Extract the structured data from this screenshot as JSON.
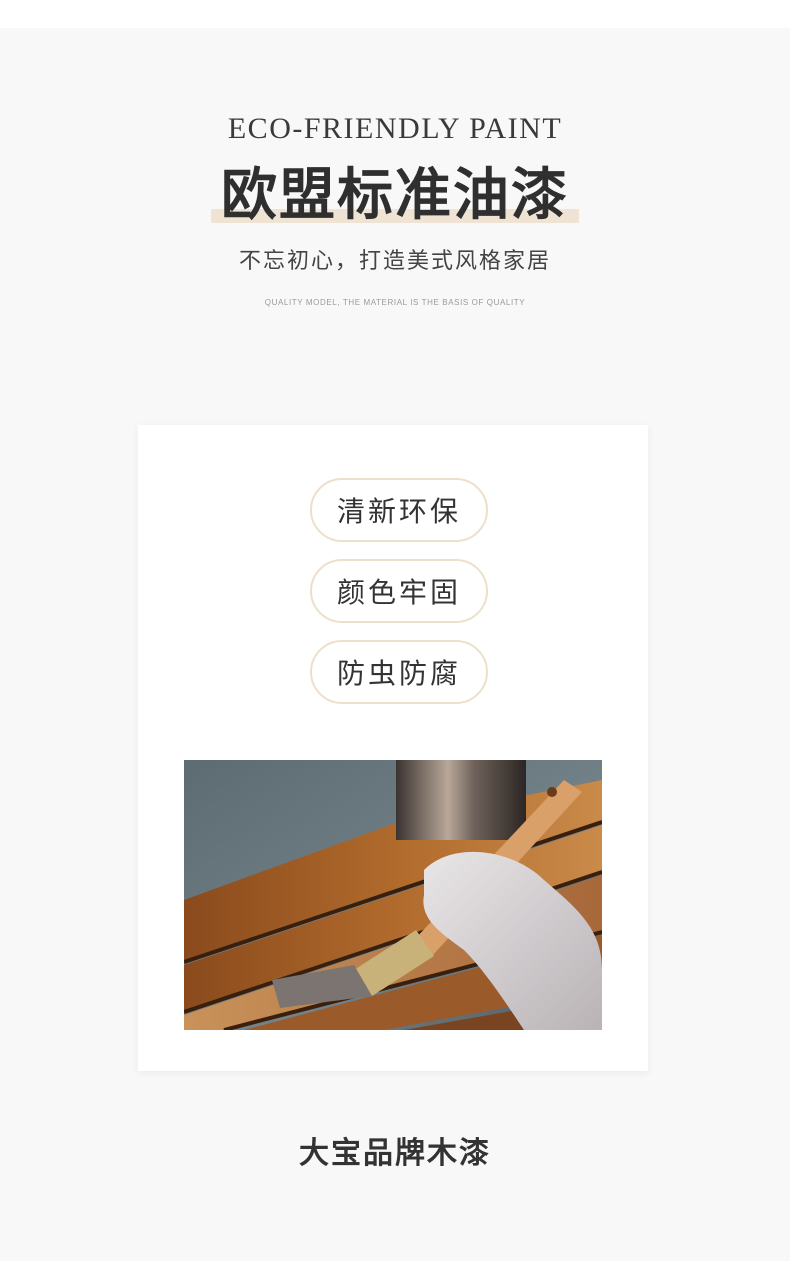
{
  "header": {
    "eco_heading": "ECO-FRIENDLY PAINT",
    "main_title": "欧盟标准油漆",
    "subtitle": "不忘初心，打造美式风格家居",
    "quality_line": "QUALITY MODEL, THE MATERIAL IS THE BASIS OF QUALITY"
  },
  "features": [
    {
      "label": "清新环保"
    },
    {
      "label": "颜色牢固"
    },
    {
      "label": "防虫防腐"
    }
  ],
  "photo": {
    "subject": "gloved-hand-brushing-wood-stain-photo"
  },
  "footer": {
    "brand": "大宝品牌木漆"
  },
  "colors": {
    "page_background": "#f8f8f8",
    "card_background": "#ffffff",
    "pill_border": "#eedfcc",
    "title_highlight": "#efe3d3"
  }
}
